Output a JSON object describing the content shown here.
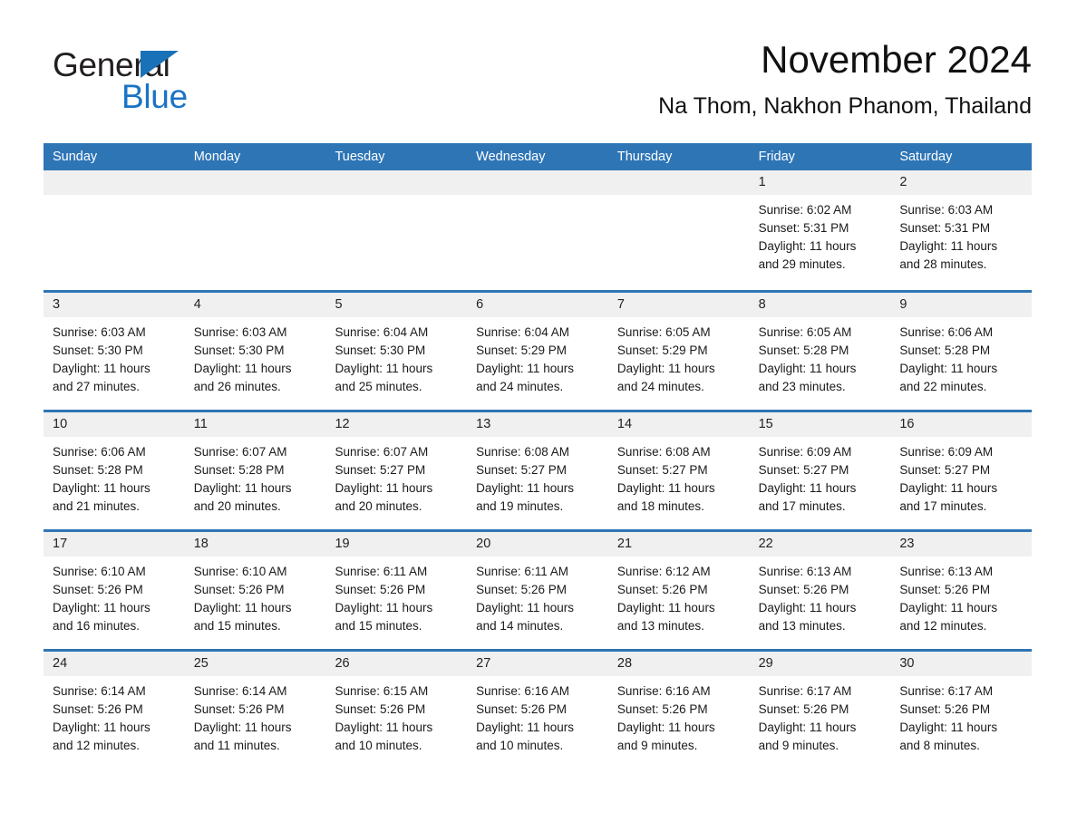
{
  "brand": {
    "name_part1": "General",
    "name_part2": "Blue",
    "triangle_color": "#1972b8",
    "text_color": "#231f20",
    "accent_color": "#1a73c4"
  },
  "header": {
    "month_title": "November 2024",
    "location": "Na Thom, Nakhon Phanom, Thailand"
  },
  "theme": {
    "header_band_color": "#2e75b6",
    "day_band_color": "#f0f0f0",
    "row_separator_color": "#2e75b6"
  },
  "weekdays": [
    "Sunday",
    "Monday",
    "Tuesday",
    "Wednesday",
    "Thursday",
    "Friday",
    "Saturday"
  ],
  "weeks": [
    [
      {
        "day": "",
        "lines": []
      },
      {
        "day": "",
        "lines": []
      },
      {
        "day": "",
        "lines": []
      },
      {
        "day": "",
        "lines": []
      },
      {
        "day": "",
        "lines": []
      },
      {
        "day": "1",
        "lines": [
          "Sunrise: 6:02 AM",
          "Sunset: 5:31 PM",
          "Daylight: 11 hours",
          "and 29 minutes."
        ]
      },
      {
        "day": "2",
        "lines": [
          "Sunrise: 6:03 AM",
          "Sunset: 5:31 PM",
          "Daylight: 11 hours",
          "and 28 minutes."
        ]
      }
    ],
    [
      {
        "day": "3",
        "lines": [
          "Sunrise: 6:03 AM",
          "Sunset: 5:30 PM",
          "Daylight: 11 hours",
          "and 27 minutes."
        ]
      },
      {
        "day": "4",
        "lines": [
          "Sunrise: 6:03 AM",
          "Sunset: 5:30 PM",
          "Daylight: 11 hours",
          "and 26 minutes."
        ]
      },
      {
        "day": "5",
        "lines": [
          "Sunrise: 6:04 AM",
          "Sunset: 5:30 PM",
          "Daylight: 11 hours",
          "and 25 minutes."
        ]
      },
      {
        "day": "6",
        "lines": [
          "Sunrise: 6:04 AM",
          "Sunset: 5:29 PM",
          "Daylight: 11 hours",
          "and 24 minutes."
        ]
      },
      {
        "day": "7",
        "lines": [
          "Sunrise: 6:05 AM",
          "Sunset: 5:29 PM",
          "Daylight: 11 hours",
          "and 24 minutes."
        ]
      },
      {
        "day": "8",
        "lines": [
          "Sunrise: 6:05 AM",
          "Sunset: 5:28 PM",
          "Daylight: 11 hours",
          "and 23 minutes."
        ]
      },
      {
        "day": "9",
        "lines": [
          "Sunrise: 6:06 AM",
          "Sunset: 5:28 PM",
          "Daylight: 11 hours",
          "and 22 minutes."
        ]
      }
    ],
    [
      {
        "day": "10",
        "lines": [
          "Sunrise: 6:06 AM",
          "Sunset: 5:28 PM",
          "Daylight: 11 hours",
          "and 21 minutes."
        ]
      },
      {
        "day": "11",
        "lines": [
          "Sunrise: 6:07 AM",
          "Sunset: 5:28 PM",
          "Daylight: 11 hours",
          "and 20 minutes."
        ]
      },
      {
        "day": "12",
        "lines": [
          "Sunrise: 6:07 AM",
          "Sunset: 5:27 PM",
          "Daylight: 11 hours",
          "and 20 minutes."
        ]
      },
      {
        "day": "13",
        "lines": [
          "Sunrise: 6:08 AM",
          "Sunset: 5:27 PM",
          "Daylight: 11 hours",
          "and 19 minutes."
        ]
      },
      {
        "day": "14",
        "lines": [
          "Sunrise: 6:08 AM",
          "Sunset: 5:27 PM",
          "Daylight: 11 hours",
          "and 18 minutes."
        ]
      },
      {
        "day": "15",
        "lines": [
          "Sunrise: 6:09 AM",
          "Sunset: 5:27 PM",
          "Daylight: 11 hours",
          "and 17 minutes."
        ]
      },
      {
        "day": "16",
        "lines": [
          "Sunrise: 6:09 AM",
          "Sunset: 5:27 PM",
          "Daylight: 11 hours",
          "and 17 minutes."
        ]
      }
    ],
    [
      {
        "day": "17",
        "lines": [
          "Sunrise: 6:10 AM",
          "Sunset: 5:26 PM",
          "Daylight: 11 hours",
          "and 16 minutes."
        ]
      },
      {
        "day": "18",
        "lines": [
          "Sunrise: 6:10 AM",
          "Sunset: 5:26 PM",
          "Daylight: 11 hours",
          "and 15 minutes."
        ]
      },
      {
        "day": "19",
        "lines": [
          "Sunrise: 6:11 AM",
          "Sunset: 5:26 PM",
          "Daylight: 11 hours",
          "and 15 minutes."
        ]
      },
      {
        "day": "20",
        "lines": [
          "Sunrise: 6:11 AM",
          "Sunset: 5:26 PM",
          "Daylight: 11 hours",
          "and 14 minutes."
        ]
      },
      {
        "day": "21",
        "lines": [
          "Sunrise: 6:12 AM",
          "Sunset: 5:26 PM",
          "Daylight: 11 hours",
          "and 13 minutes."
        ]
      },
      {
        "day": "22",
        "lines": [
          "Sunrise: 6:13 AM",
          "Sunset: 5:26 PM",
          "Daylight: 11 hours",
          "and 13 minutes."
        ]
      },
      {
        "day": "23",
        "lines": [
          "Sunrise: 6:13 AM",
          "Sunset: 5:26 PM",
          "Daylight: 11 hours",
          "and 12 minutes."
        ]
      }
    ],
    [
      {
        "day": "24",
        "lines": [
          "Sunrise: 6:14 AM",
          "Sunset: 5:26 PM",
          "Daylight: 11 hours",
          "and 12 minutes."
        ]
      },
      {
        "day": "25",
        "lines": [
          "Sunrise: 6:14 AM",
          "Sunset: 5:26 PM",
          "Daylight: 11 hours",
          "and 11 minutes."
        ]
      },
      {
        "day": "26",
        "lines": [
          "Sunrise: 6:15 AM",
          "Sunset: 5:26 PM",
          "Daylight: 11 hours",
          "and 10 minutes."
        ]
      },
      {
        "day": "27",
        "lines": [
          "Sunrise: 6:16 AM",
          "Sunset: 5:26 PM",
          "Daylight: 11 hours",
          "and 10 minutes."
        ]
      },
      {
        "day": "28",
        "lines": [
          "Sunrise: 6:16 AM",
          "Sunset: 5:26 PM",
          "Daylight: 11 hours",
          "and 9 minutes."
        ]
      },
      {
        "day": "29",
        "lines": [
          "Sunrise: 6:17 AM",
          "Sunset: 5:26 PM",
          "Daylight: 11 hours",
          "and 9 minutes."
        ]
      },
      {
        "day": "30",
        "lines": [
          "Sunrise: 6:17 AM",
          "Sunset: 5:26 PM",
          "Daylight: 11 hours",
          "and 8 minutes."
        ]
      }
    ]
  ]
}
